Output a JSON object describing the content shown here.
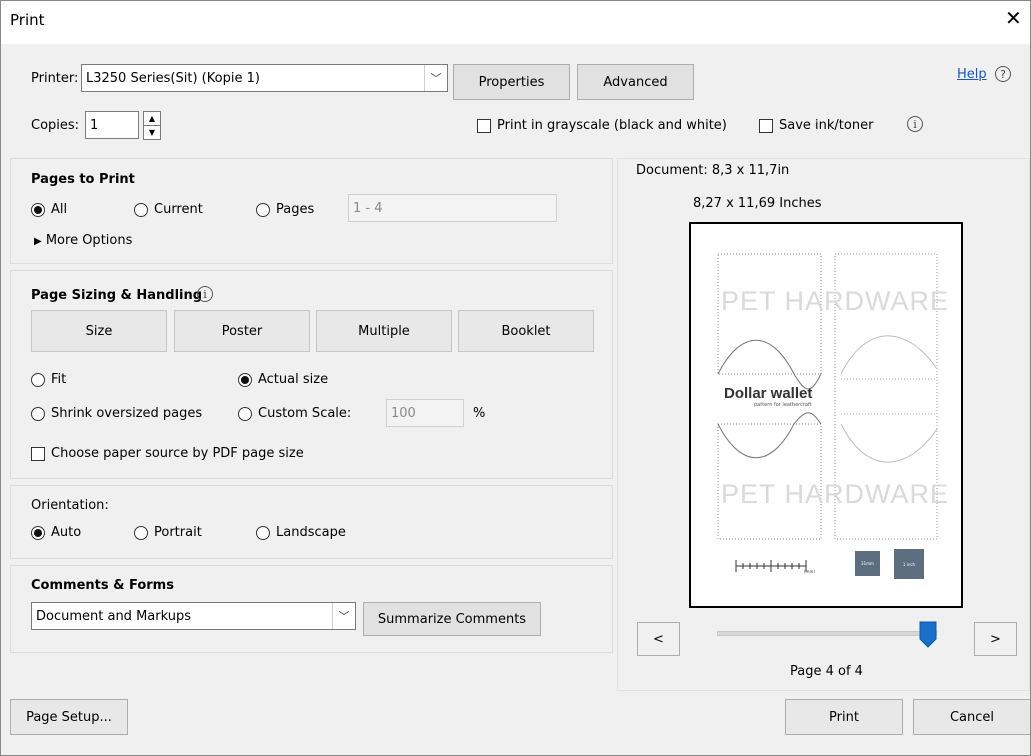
{
  "window": {
    "title": "Print",
    "close_glyph": "✕"
  },
  "printer": {
    "label": "Printer:",
    "selected": "L3250 Series(Sit) (Kopie 1)",
    "properties_label": "Properties",
    "advanced_label": "Advanced",
    "help_label": "Help",
    "copies_label": "Copies:",
    "copies_value": "1",
    "grayscale_label": "Print in grayscale (black and white)",
    "saveink_label": "Save ink/toner"
  },
  "pages_to_print": {
    "heading": "Pages to Print",
    "all_label": "All",
    "current_label": "Current",
    "pages_label": "Pages",
    "pages_value": "1 - 4",
    "more_options_label": "More Options",
    "selected": "all"
  },
  "sizing": {
    "heading": "Page Sizing & Handling",
    "tabs": [
      "Size",
      "Poster",
      "Multiple",
      "Booklet"
    ],
    "fit_label": "Fit",
    "actual_label": "Actual size",
    "shrink_label": "Shrink oversized pages",
    "custom_label": "Custom Scale:",
    "custom_value": "100",
    "percent": "%",
    "paper_source_label": "Choose paper source by PDF page size",
    "selected": "actual"
  },
  "orientation": {
    "heading": "Orientation:",
    "auto_label": "Auto",
    "portrait_label": "Portrait",
    "landscape_label": "Landscape",
    "selected": "auto"
  },
  "comments": {
    "heading": "Comments & Forms",
    "selected": "Document and Markups",
    "summarize_label": "Summarize Comments"
  },
  "preview": {
    "document_size": "Document: 8,3 x 11,7in",
    "page_size": "8,27 x 11,69 Inches",
    "watermark": "PET HARDWARE",
    "wallet_title": "Dollar wallet",
    "wallet_subtitle": "pattern for leathercraft",
    "swatch_1": "31mm",
    "swatch_2": "1 inch",
    "scale_unit": "(mm)",
    "prev_label": "<",
    "next_label": ">",
    "page_indicator": "Page 4 of 4",
    "slider_fraction": 1.0
  },
  "footer": {
    "page_setup_label": "Page Setup...",
    "print_label": "Print",
    "cancel_label": "Cancel"
  },
  "colors": {
    "accent": "#1a6fc9",
    "swatch": "#5c6e80"
  }
}
